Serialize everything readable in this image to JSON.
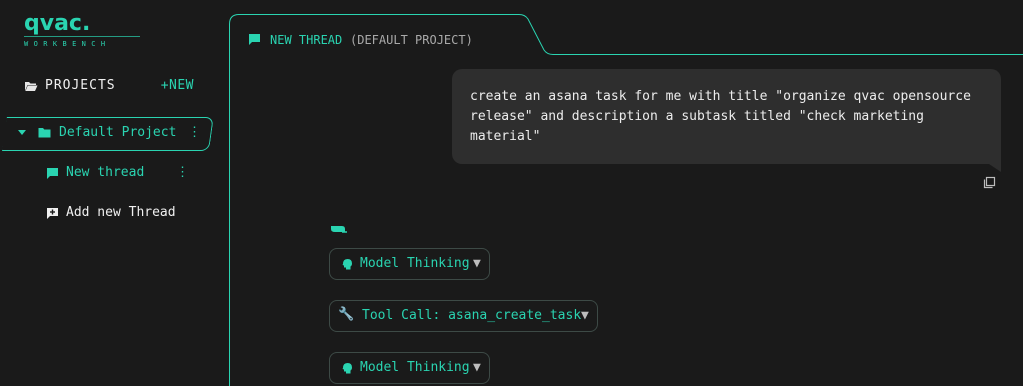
{
  "brand": {
    "logo_text": "qvac.",
    "subtitle": "WORKBENCH",
    "accent_color": "#2ad4b1"
  },
  "sidebar": {
    "projects_label": "PROJECTS",
    "new_label": "+NEW",
    "projects": [
      {
        "label": "Default Project",
        "expanded": true,
        "threads": [
          {
            "label": "New thread",
            "active": true
          }
        ]
      }
    ],
    "add_thread_label": "Add new Thread",
    "icons": {
      "projects": "folder-open-icon",
      "project": "folder-icon",
      "thread": "chat-bubble-icon",
      "add_thread": "add-chat-icon",
      "menu": "kebab-menu-icon"
    }
  },
  "thread": {
    "title": "NEW THREAD",
    "project_context": "(DEFAULT PROJECT)",
    "messages": [
      {
        "role": "user",
        "text": "create an asana task for me with title \"organize qvac opensource\nrelease\" and description a subtask titled \"check marketing\nmaterial\""
      }
    ],
    "assistant_steps": [
      {
        "icon": "head-icon",
        "label": "Model Thinking",
        "caret": "▼"
      },
      {
        "icon": "wrench-icon",
        "label": "Tool Call: asana_create_task",
        "caret": "▼",
        "icon_glyph": "🔧"
      },
      {
        "icon": "head-icon",
        "label": "Model Thinking",
        "caret": "▼"
      }
    ]
  },
  "colors": {
    "background": "#1a1a1a",
    "bubble": "#2e2e2e",
    "accent": "#2ad4b1",
    "muted_text": "#a9a9a9"
  }
}
